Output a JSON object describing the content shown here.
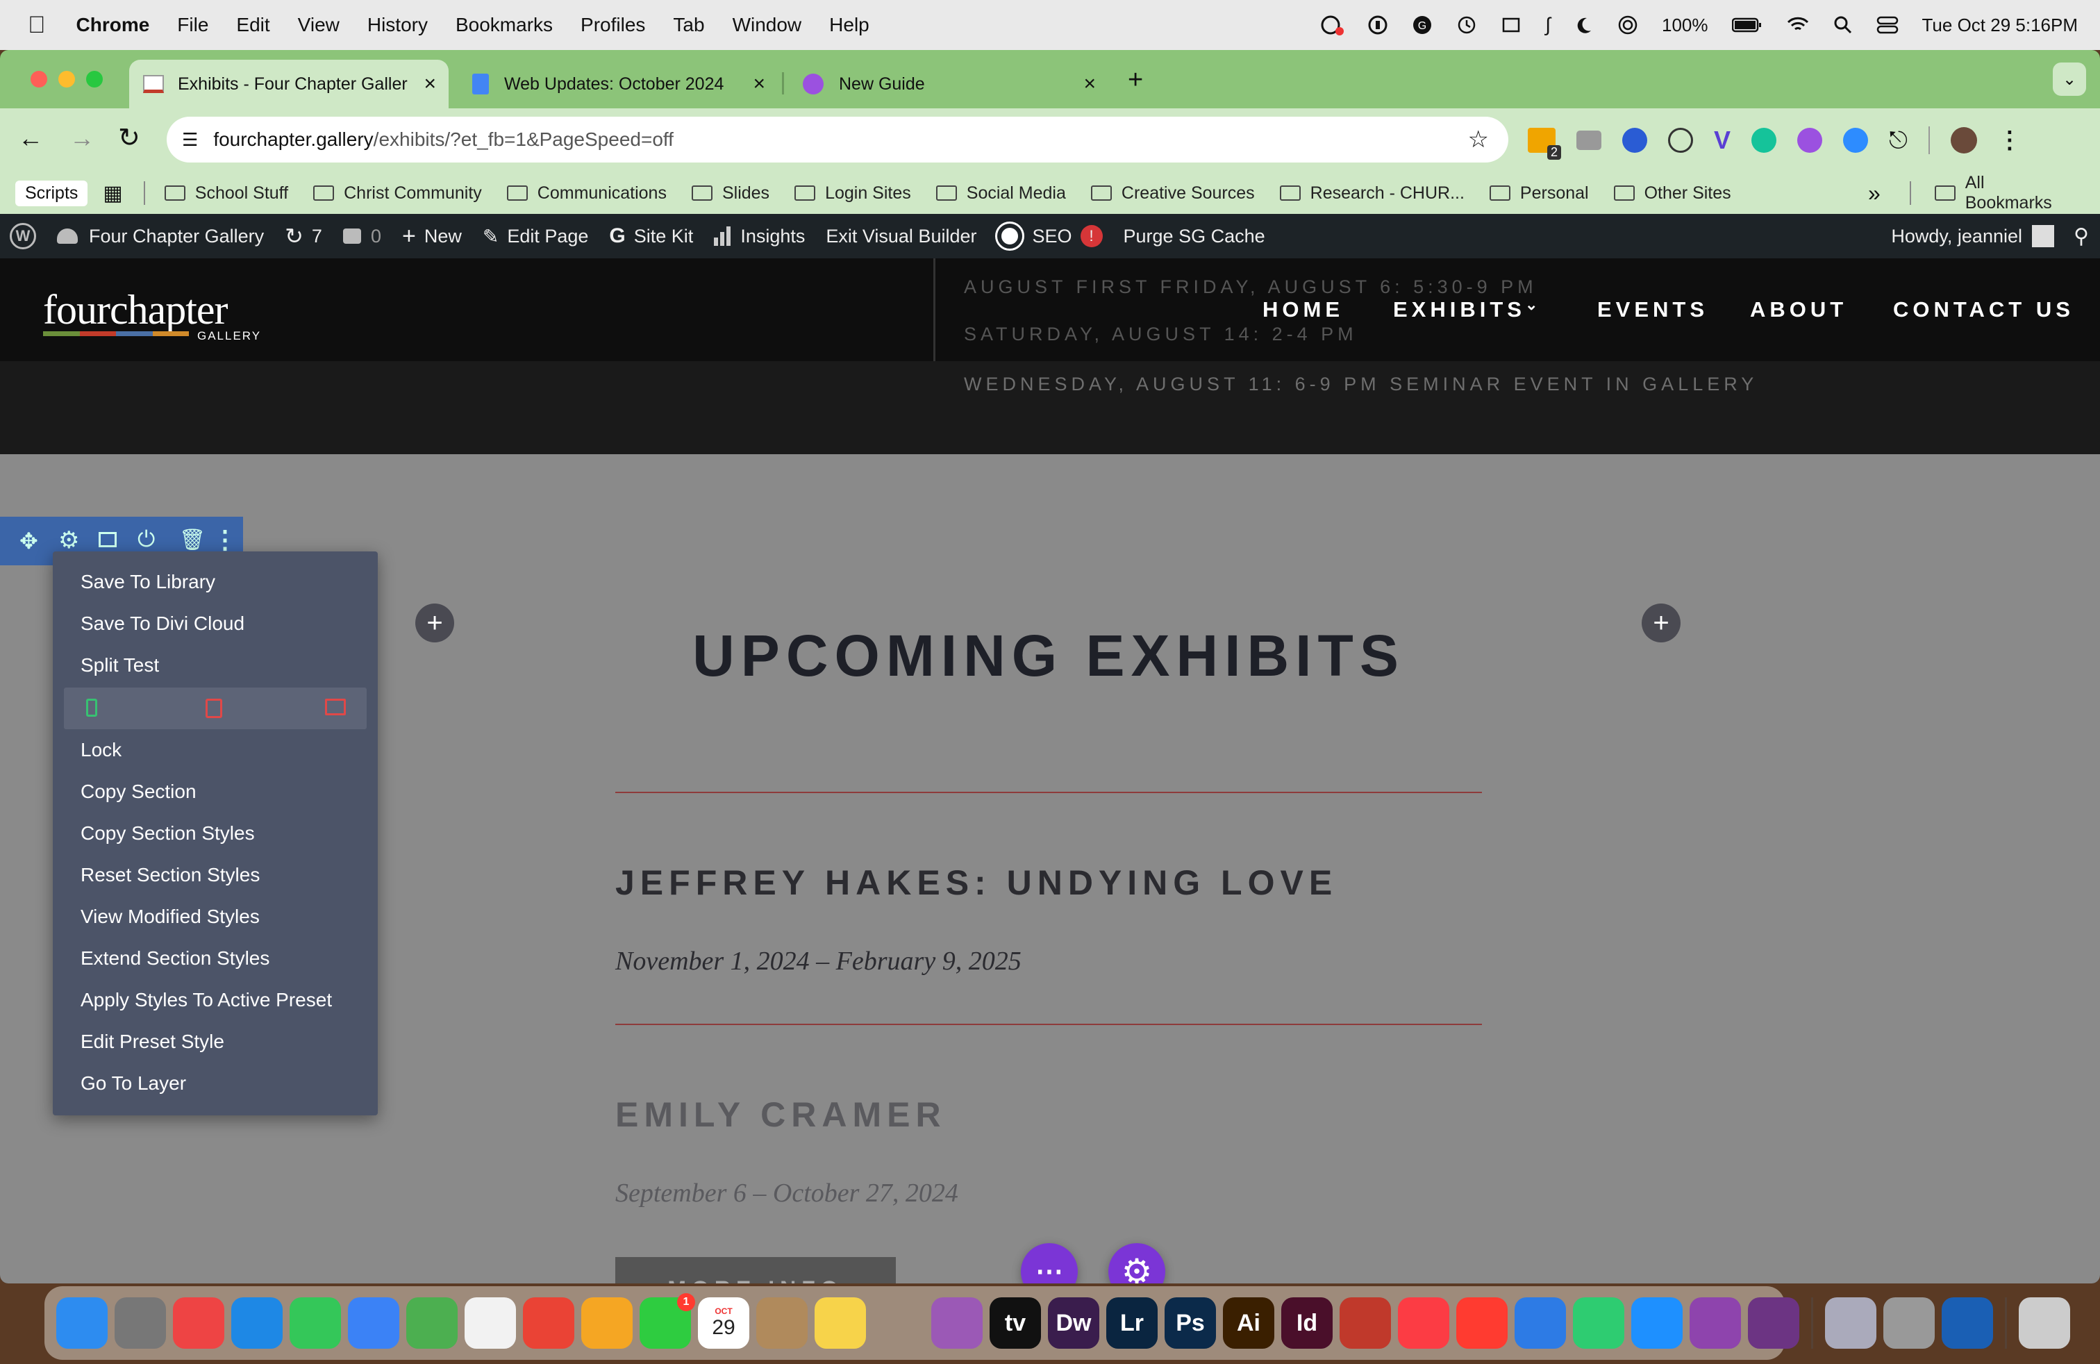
{
  "menubar": {
    "app_name": "Chrome",
    "items": [
      "File",
      "Edit",
      "View",
      "History",
      "Bookmarks",
      "Profiles",
      "Tab",
      "Window",
      "Help"
    ],
    "battery": "100%",
    "datetime": "Tue Oct 29  5:16PM"
  },
  "tabs": [
    {
      "title": "Exhibits - Four Chapter Galler",
      "icon": "gallery-favicon"
    },
    {
      "title": "Web Updates: October 2024",
      "icon": "docs-icon"
    },
    {
      "title": "New Guide",
      "icon": "guide-icon"
    }
  ],
  "omnibox": {
    "domain": "fourchapter.gallery",
    "path": "/exhibits/?et_fb=1&PageSpeed=off"
  },
  "extensions": {
    "badge_count": "2"
  },
  "bookmarks": {
    "scripts_label": "Scripts",
    "items": [
      "School Stuff",
      "Christ Community",
      "Communications",
      "Slides",
      "Login Sites",
      "Social Media",
      "Creative Sources",
      "Research - CHUR...",
      "Personal",
      "Other Sites"
    ],
    "overflow": "»",
    "all_label": "All Bookmarks"
  },
  "wp_admin_bar": {
    "site_name": "Four Chapter Gallery",
    "updates": "7",
    "comments": "0",
    "new_label": "New",
    "edit_page_label": "Edit Page",
    "site_kit_label": "Site Kit",
    "insights_label": "Insights",
    "exit_vb_label": "Exit Visual Builder",
    "seo_label": "SEO",
    "seo_alert": "!",
    "purge_label": "Purge SG Cache",
    "howdy_label": "Howdy, jeanniel"
  },
  "site": {
    "logo_text": "fourchapter",
    "logo_sub": "GALLERY",
    "logo_colors": [
      "#6b8f3a",
      "#c23b2a",
      "#4a6fa5",
      "#d08a2a"
    ],
    "nav": [
      "HOME",
      "EXHIBITS",
      "EVENTS",
      "ABOUT",
      "CONTACT US"
    ],
    "ghost_lines": [
      "AUGUST  FIRST FRIDAY, AUGUST 6: 5:30-9 PM",
      "SATURDAY, AUGUST 14: 2-4 PM",
      "WEDNESDAY, AUGUST 11: 6-9 PM SEMINAR EVENT IN GALLERY"
    ],
    "heading": "UPCOMING EXHIBITS",
    "exhibits": [
      {
        "title": "JEFFREY HAKES: UNDYING LOVE",
        "dates": "November 1, 2024 – February 9, 2025"
      },
      {
        "title": "EMILY CRAMER",
        "dates": "September 6 – October 27, 2024"
      }
    ],
    "more_info_label": "MORE INFO",
    "accent_color": "#8e3b3b"
  },
  "context_menu": {
    "items_top": [
      "Save To Library",
      "Save To Divi Cloud",
      "Split Test"
    ],
    "items_bottom": [
      "Lock",
      "Copy Section",
      "Copy Section Styles",
      "Reset Section Styles",
      "View Modified Styles",
      "Extend Section Styles",
      "Apply Styles To Active Preset",
      "Edit Preset Style",
      "Go To Layer"
    ]
  },
  "dock_apps": [
    {
      "name": "Finder",
      "color": "#2d8cf0",
      "label": ""
    },
    {
      "name": "System Settings",
      "color": "#777",
      "label": ""
    },
    {
      "name": "Launchpad",
      "color": "#e44",
      "label": ""
    },
    {
      "name": "Safari",
      "color": "#1e88e5",
      "label": ""
    },
    {
      "name": "Messages",
      "color": "#34c759",
      "label": ""
    },
    {
      "name": "Mail",
      "color": "#3b82f6",
      "label": ""
    },
    {
      "name": "Maps",
      "color": "#4caf50",
      "label": ""
    },
    {
      "name": "Reminders",
      "color": "#f2f2f2",
      "label": ""
    },
    {
      "name": "Chrome",
      "color": "#ea4335",
      "label": ""
    },
    {
      "name": "Photos",
      "color": "#f5a623",
      "label": ""
    },
    {
      "name": "FaceTime",
      "color": "#2ecc40",
      "label": ""
    },
    {
      "name": "Calendar",
      "color": "#ffffff",
      "label": "29"
    },
    {
      "name": "Contacts",
      "color": "#b08a5c",
      "label": ""
    },
    {
      "name": "Notes",
      "color": "#f7d34a",
      "label": ""
    },
    {
      "name": "Script Editor",
      "color": "#ddd",
      "label": ""
    },
    {
      "name": "Podcasts",
      "color": "#9b59b6",
      "label": ""
    },
    {
      "name": "Apple TV",
      "color": "#111",
      "label": "tv"
    },
    {
      "name": "Dreamweaver",
      "color": "#3a1d4d",
      "label": "Dw"
    },
    {
      "name": "Lightroom",
      "color": "#0a2540",
      "label": "Lr"
    },
    {
      "name": "Photoshop",
      "color": "#0b2a4a",
      "label": "Ps"
    },
    {
      "name": "Illustrator",
      "color": "#3a1f00",
      "label": "Ai"
    },
    {
      "name": "InDesign",
      "color": "#4a0f2a",
      "label": "Id"
    },
    {
      "name": "Acrobat",
      "color": "#c0392b",
      "label": ""
    },
    {
      "name": "Music",
      "color": "#fc3c44",
      "label": ""
    },
    {
      "name": "News",
      "color": "#ff3b30",
      "label": ""
    },
    {
      "name": "Keynote",
      "color": "#2d7be5",
      "label": ""
    },
    {
      "name": "Numbers",
      "color": "#2ecc71",
      "label": ""
    },
    {
      "name": "App Store",
      "color": "#1e90ff",
      "label": ""
    },
    {
      "name": "Pointer",
      "color": "#8e44ad",
      "label": ""
    },
    {
      "name": "Gallery Business",
      "color": "#6c3483",
      "label": ""
    },
    {
      "name": "Preview",
      "color": "#aab",
      "label": ""
    },
    {
      "name": "Printer",
      "color": "#999",
      "label": ""
    },
    {
      "name": "1Password",
      "color": "#1a5fb4",
      "label": ""
    },
    {
      "name": "Trash",
      "color": "#ccc",
      "label": ""
    }
  ],
  "calendar_month": "OCT",
  "facetime_badge": "1"
}
